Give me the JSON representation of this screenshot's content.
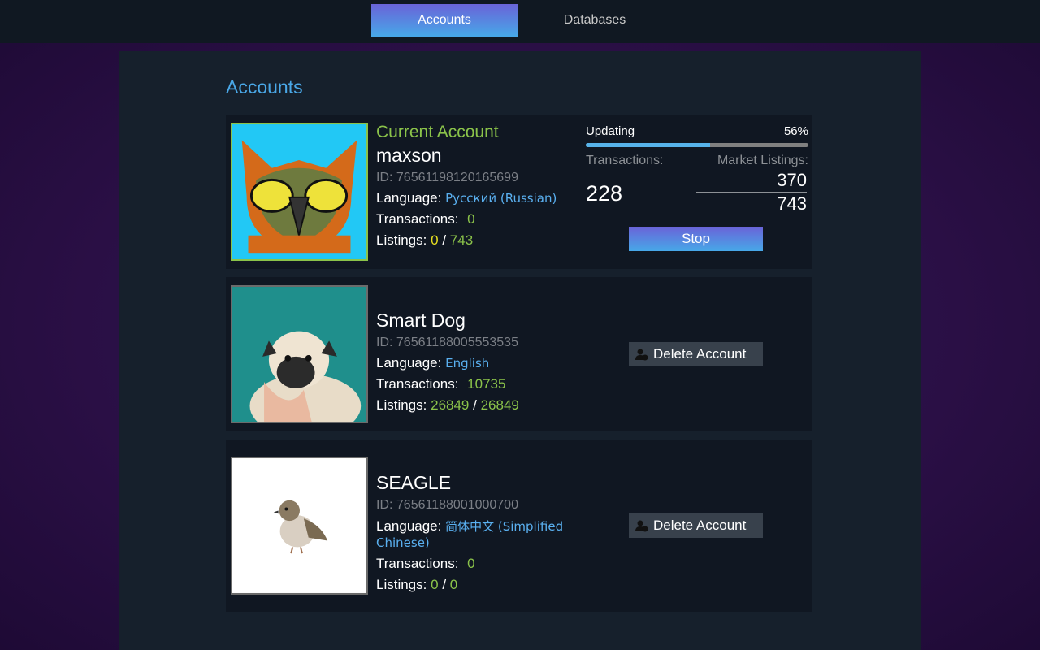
{
  "nav": {
    "tabs": [
      {
        "label": "Accounts",
        "active": true
      },
      {
        "label": "Databases",
        "active": false
      }
    ]
  },
  "page": {
    "title": "Accounts"
  },
  "accounts": [
    {
      "current_label": "Current Account",
      "name": "maxson",
      "id": "ID: 76561198120165699",
      "language_label": "Language:",
      "language_value": "Русский (Russian)",
      "transactions_label": "Transactions:",
      "transactions_value": "0",
      "listings_label": "Listings:",
      "listings_a": "0",
      "listings_sep": "/",
      "listings_b": "743",
      "avatar_icon": "owl-avatar",
      "update": {
        "status": "Updating",
        "percent_text": "56%",
        "percent": 56,
        "transactions_label": "Transactions:",
        "market_label": "Market Listings:",
        "transactions": "228",
        "market_a": "370",
        "market_b": "743",
        "stop_label": "Stop"
      }
    },
    {
      "name": "Smart Dog",
      "id": "ID: 76561188005553535",
      "language_label": "Language:",
      "language_value": "English",
      "transactions_label": "Transactions:",
      "transactions_value": "10735",
      "listings_label": "Listings:",
      "listings_a": "26849",
      "listings_sep": "/",
      "listings_b": "26849",
      "avatar_icon": "pug-avatar",
      "delete_label": "Delete Account"
    },
    {
      "name": "SEAGLE",
      "id": "ID: 76561188001000700",
      "language_label": "Language:",
      "language_value": "简体中文 (Simplified Chinese)",
      "transactions_label": "Transactions:",
      "transactions_value": "0",
      "listings_label": "Listings:",
      "listings_a": "0",
      "listings_sep": "/",
      "listings_b": "0",
      "avatar_icon": "sparrow-avatar",
      "delete_label": "Delete Account"
    }
  ],
  "colors": {
    "accent": "#4aa8e8",
    "green": "#8bc34a",
    "yellow": "#e8e020"
  }
}
